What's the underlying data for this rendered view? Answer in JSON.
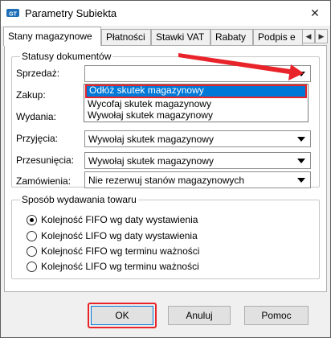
{
  "window": {
    "title": "Parametry Subiekta",
    "close_label": "✕"
  },
  "tabs": [
    {
      "label": "Stany magazynowe",
      "active": true
    },
    {
      "label": "Płatności"
    },
    {
      "label": "Stawki VAT"
    },
    {
      "label": "Rabaty"
    },
    {
      "label": "Podpis e"
    }
  ],
  "tab_scroll": {
    "left": "◀",
    "right": "▶"
  },
  "statusy": {
    "title": "Statusy dokumentów",
    "rows": [
      {
        "label": "Sprzedaż:",
        "value": ""
      },
      {
        "label": "Zakup:",
        "value": ""
      },
      {
        "label": "Wydania:",
        "value": ""
      },
      {
        "label": "Przyjęcia:",
        "value": "Wywołaj skutek magazynowy"
      },
      {
        "label": "Przesunięcia:",
        "value": "Wywołaj skutek magazynowy"
      },
      {
        "label": "Zamówienia:",
        "value": "Nie rezerwuj stanów magazynowych"
      }
    ],
    "dropdown_options": [
      "Odłóż skutek magazynowy",
      "Wycofaj skutek magazynowy",
      "Wywołaj skutek magazynowy"
    ],
    "selected_option": "Odłóż skutek magazynowy"
  },
  "sposob": {
    "title": "Sposób wydawania towaru",
    "options": [
      {
        "label": "Kolejność FIFO wg daty wystawienia",
        "checked": true
      },
      {
        "label": "Kolejność LIFO wg daty wystawienia",
        "checked": false
      },
      {
        "label": "Kolejność FIFO wg terminu ważności",
        "checked": false
      },
      {
        "label": "Kolejność LIFO wg terminu ważności",
        "checked": false
      }
    ]
  },
  "buttons": {
    "ok": "OK",
    "cancel": "Anuluj",
    "help": "Pomoc"
  },
  "colors": {
    "selection": "#0078d7",
    "annotation": "#e8232a"
  }
}
